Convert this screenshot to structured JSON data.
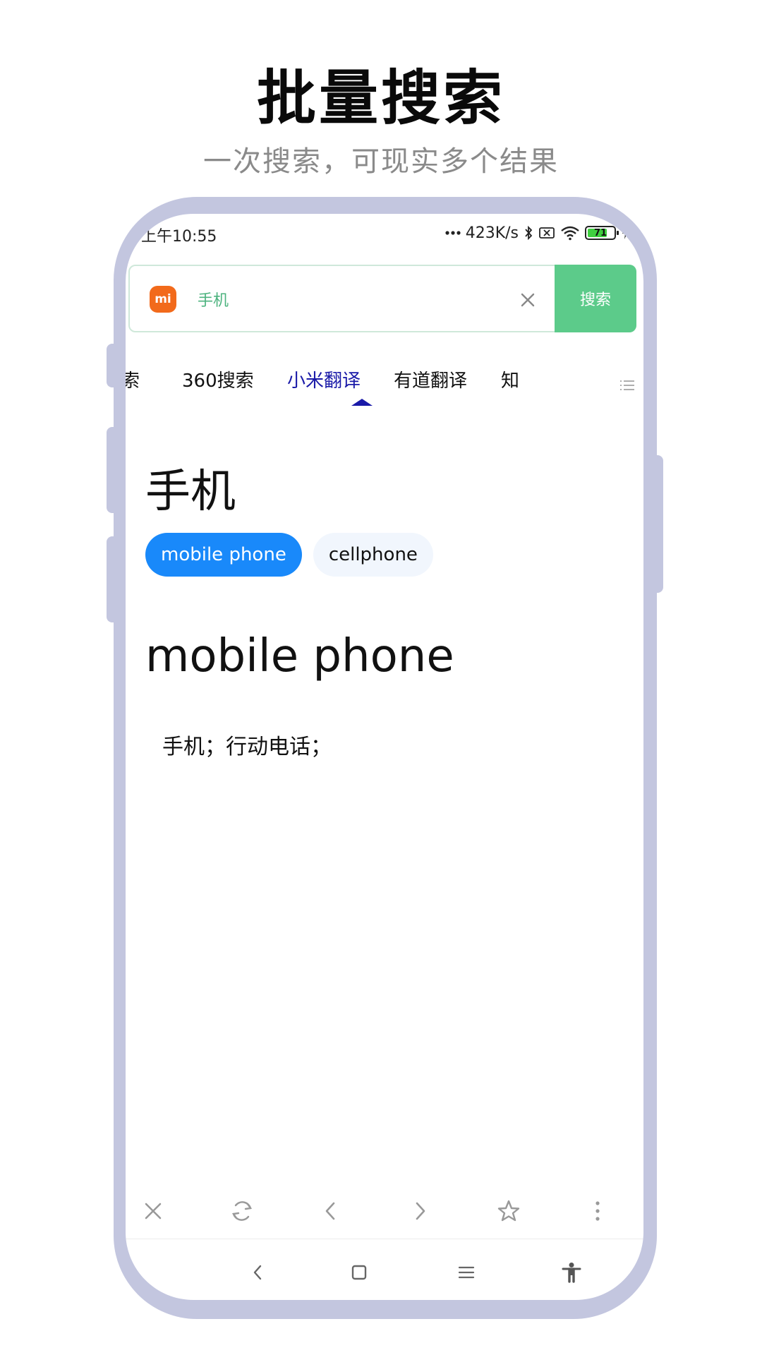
{
  "promo": {
    "headline": "批量搜索",
    "subline": "一次搜索，可现实多个结果"
  },
  "status_bar": {
    "time": "上午10:55",
    "network_speed": "423K/s",
    "battery_level": "71",
    "icons": [
      "more-dots-icon",
      "bluetooth-icon",
      "sim-off-icon",
      "wifi-icon",
      "battery-icon",
      "charging-icon"
    ]
  },
  "search": {
    "engine_logo": "mi",
    "query": "手机",
    "button_label": "搜索"
  },
  "tabs": {
    "items": [
      "索",
      "360搜索",
      "小米翻译",
      "有道翻译",
      "知"
    ],
    "active": "小米翻译"
  },
  "result": {
    "word": "手机",
    "chips": [
      "mobile phone",
      "cellphone"
    ],
    "active_chip": "mobile phone",
    "heading": "mobile phone",
    "meaning": "手机；行动电话；"
  },
  "toolbar": {
    "items": [
      "close-icon",
      "refresh-icon",
      "back-icon",
      "forward-icon",
      "star-icon",
      "more-vertical-icon"
    ]
  },
  "nav_bar": {
    "items": [
      "nav-back-icon",
      "nav-home-icon",
      "nav-recents-icon",
      "accessibility-icon"
    ]
  },
  "colors": {
    "frame": "#c3c6df",
    "search_button": "#5ccb8a",
    "query_text": "#4db37f",
    "active_tab": "#1a1aa8",
    "active_chip": "#1989fa",
    "inactive_chip": "#f1f6fd",
    "mi_logo": "#f26a1b",
    "battery_fill": "#3fcf3f"
  }
}
